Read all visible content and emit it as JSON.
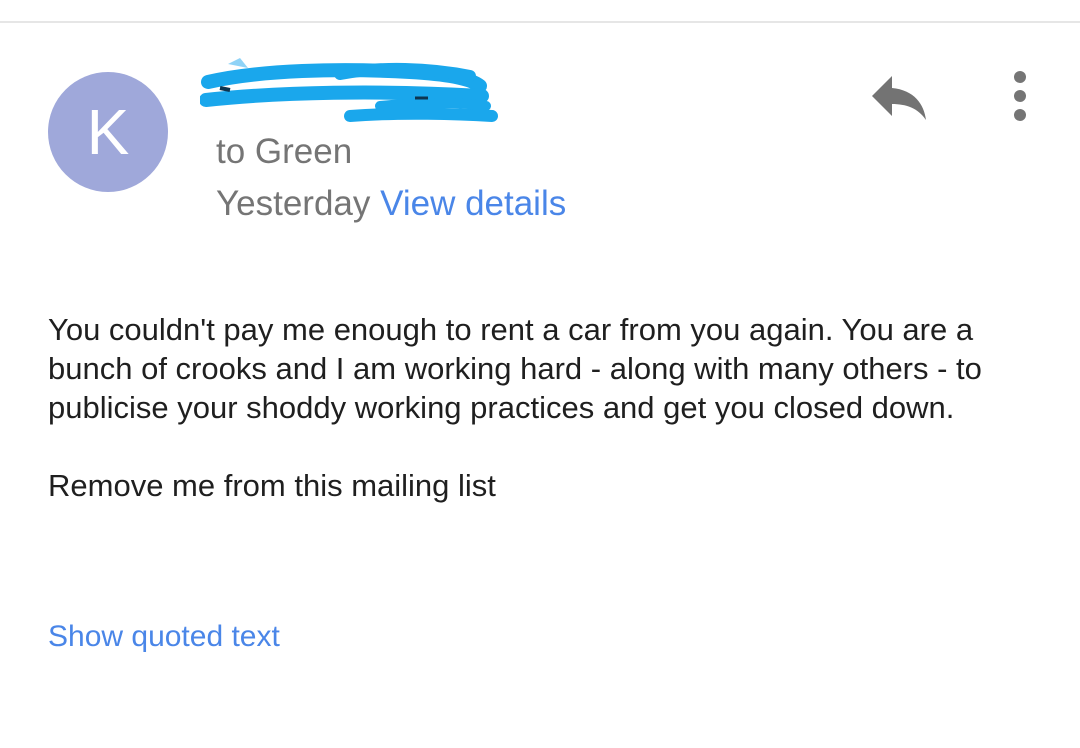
{
  "header": {
    "avatar_letter": "K",
    "recipient": "to Green",
    "date": "Yesterday",
    "view_details_label": "View details"
  },
  "actions": {
    "reply_icon": "reply-icon",
    "more_icon": "more-vert-icon"
  },
  "message": {
    "paragraph_1": "You couldn't pay me enough to rent a car from you again. You are a bunch of crooks and I am working hard - along with many others - to publicise your shoddy working practices and get you closed down.",
    "paragraph_2": "Remove me from this mailing list"
  },
  "footer": {
    "show_quoted_label": "Show quoted text"
  },
  "colors": {
    "avatar_bg": "#9fa8da",
    "link": "#4a86e8",
    "secondary_text": "#757575",
    "redaction": "#1aa7ec"
  }
}
